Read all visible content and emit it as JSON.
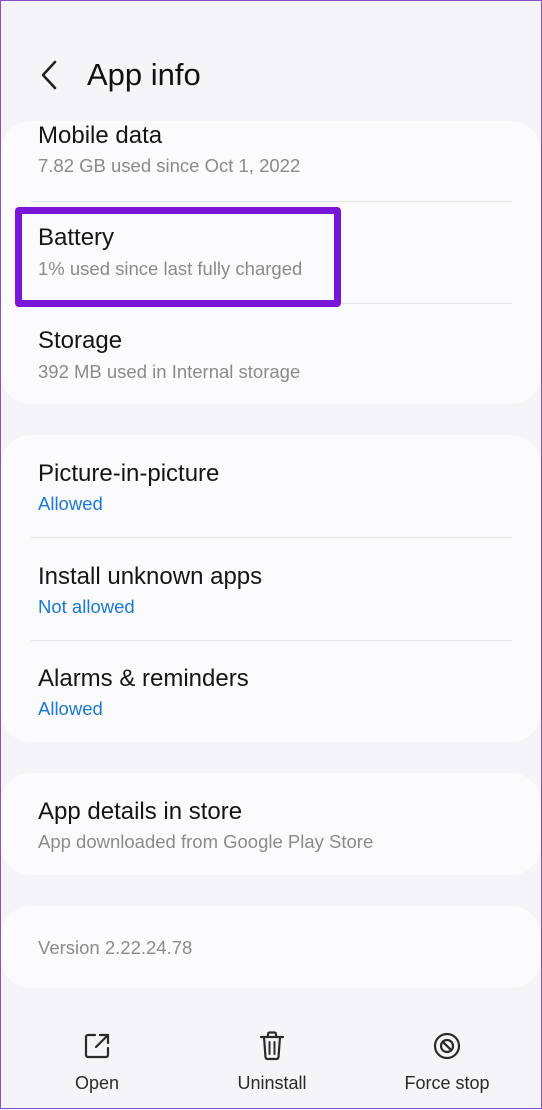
{
  "header": {
    "title": "App info",
    "back_icon": "chevron-left-icon"
  },
  "usage": {
    "mobile_data": {
      "label": "Mobile data",
      "sub": "7.82 GB used since Oct 1, 2022"
    },
    "battery": {
      "label": "Battery",
      "sub": "1% used since last fully charged"
    },
    "storage": {
      "label": "Storage",
      "sub": "392 MB used in Internal storage"
    }
  },
  "permissions": {
    "pip": {
      "label": "Picture-in-picture",
      "sub": "Allowed"
    },
    "unknown_apps": {
      "label": "Install unknown apps",
      "sub": "Not allowed"
    },
    "alarms": {
      "label": "Alarms & reminders",
      "sub": "Allowed"
    }
  },
  "store": {
    "label": "App details in store",
    "sub": "App downloaded from Google Play Store"
  },
  "version": "Version 2.22.24.78",
  "actions": {
    "open": {
      "label": "Open",
      "icon": "open-external-icon"
    },
    "uninstall": {
      "label": "Uninstall",
      "icon": "trash-icon"
    },
    "force_stop": {
      "label": "Force stop",
      "icon": "stop-circle-icon"
    }
  },
  "colors": {
    "background": "#f5f4f8",
    "card": "#fbfbfd",
    "link_blue": "#1a78d6",
    "highlight": "#7a16d8"
  }
}
